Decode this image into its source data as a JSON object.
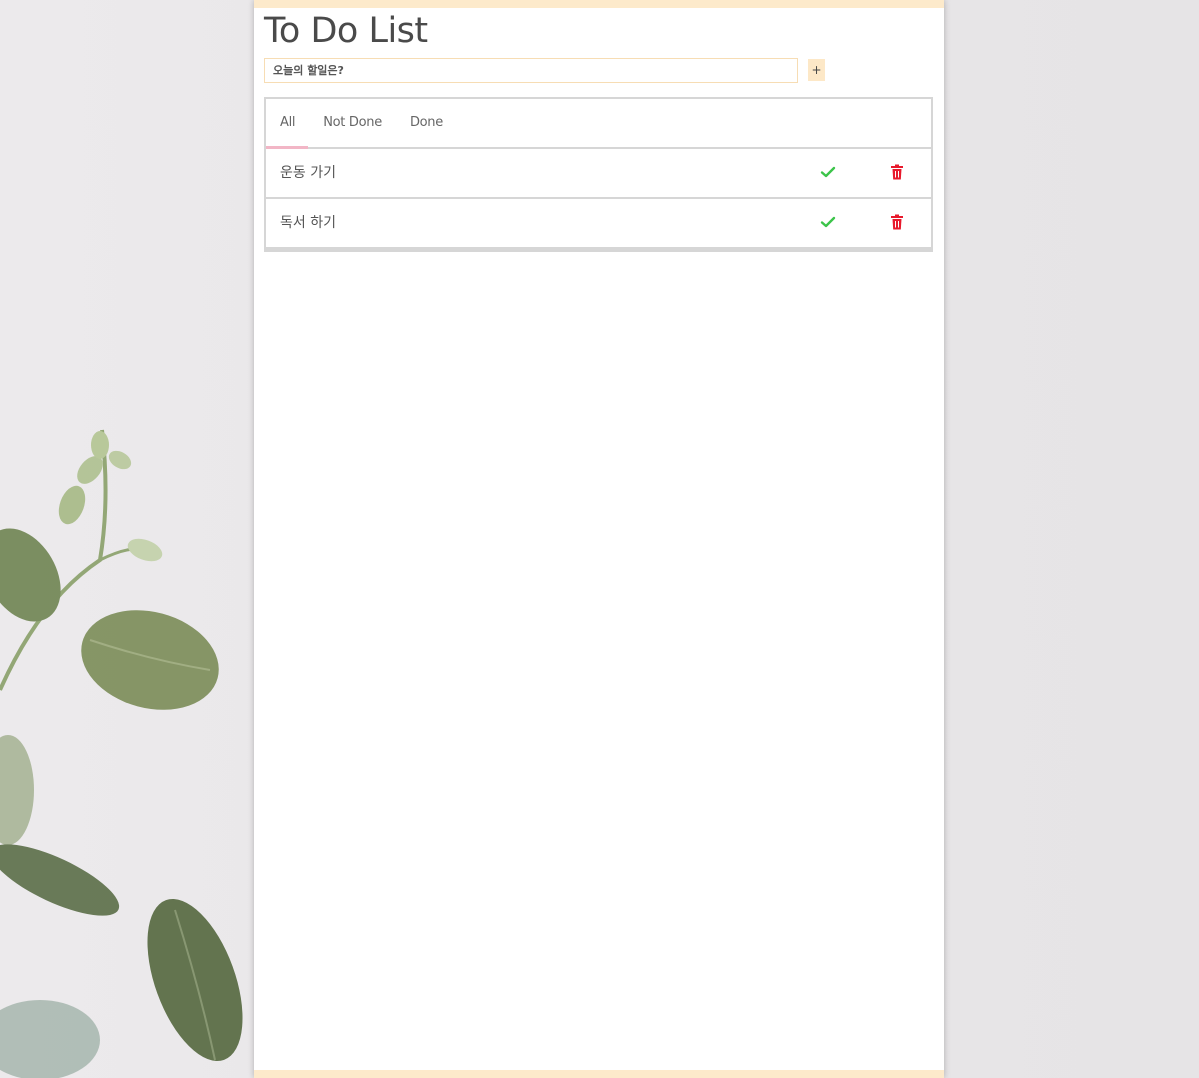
{
  "app": {
    "title": "To Do List"
  },
  "input": {
    "placeholder": "오늘의 할일은?",
    "value": ""
  },
  "add_button": {
    "label": "+"
  },
  "tabs": [
    {
      "label": "All",
      "active": true
    },
    {
      "label": "Not Done",
      "active": false
    },
    {
      "label": "Done",
      "active": false
    }
  ],
  "tasks": [
    {
      "text": "운동 가기",
      "complete_icon": "check-icon",
      "delete_icon": "trash-icon"
    },
    {
      "text": "독서 하기",
      "complete_icon": "check-icon",
      "delete_icon": "trash-icon"
    }
  ],
  "colors": {
    "accent_border": "#fdeacb",
    "tab_underline": "#f2b6c6",
    "check": "#3cc44a",
    "delete": "#e8192c"
  }
}
